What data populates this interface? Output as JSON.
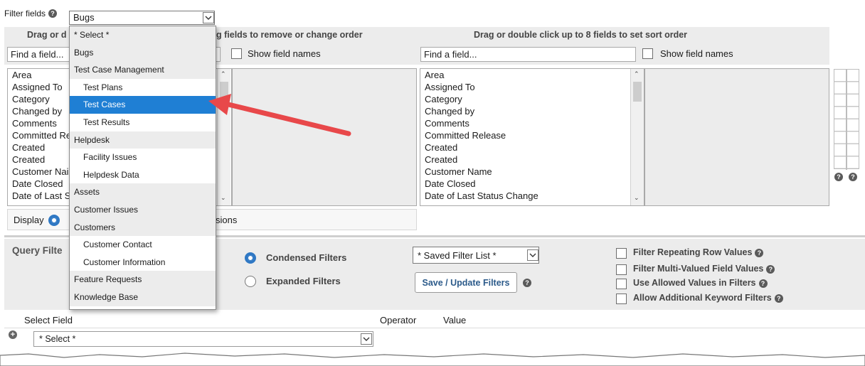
{
  "filter": {
    "label": "Filter fields",
    "selected": "Bugs"
  },
  "dropdown": {
    "items": [
      {
        "label": "* Select *",
        "kind": "group"
      },
      {
        "label": "Bugs",
        "kind": "group"
      },
      {
        "label": "Test Case Management",
        "kind": "group"
      },
      {
        "label": "Test Plans",
        "kind": "child"
      },
      {
        "label": "Test Cases",
        "kind": "child",
        "selected": true
      },
      {
        "label": "Test Results",
        "kind": "child"
      },
      {
        "label": "Helpdesk",
        "kind": "group"
      },
      {
        "label": "Facility Issues",
        "kind": "child"
      },
      {
        "label": "Helpdesk Data",
        "kind": "child"
      },
      {
        "label": "Assets",
        "kind": "group"
      },
      {
        "label": "Customer Issues",
        "kind": "group"
      },
      {
        "label": "Customers",
        "kind": "group"
      },
      {
        "label": "Customer Contact",
        "kind": "child"
      },
      {
        "label": "Customer Information",
        "kind": "child"
      },
      {
        "label": "Feature Requests",
        "kind": "group"
      },
      {
        "label": "Knowledge Base",
        "kind": "group"
      }
    ]
  },
  "left_panel": {
    "header_visible_start": "Drag or d",
    "header_visible_end": "g fields to remove or change order",
    "find_placeholder": "Find a field...",
    "show_field_names": "Show field names",
    "fields": [
      "Area",
      "Assigned To",
      "Category",
      "Changed by",
      "Comments",
      "Committed Re",
      "Created",
      "Created",
      "Customer Nai",
      "Date Closed",
      "Date of Last S"
    ],
    "display_label": "Display",
    "display_tail": "sions"
  },
  "right_panel": {
    "header": "Drag or double click up to 8 fields to set sort order",
    "find_placeholder": "Find a field...",
    "show_field_names": "Show field names",
    "fields": [
      "Area",
      "Assigned To",
      "Category",
      "Changed by",
      "Comments",
      "Committed Release",
      "Created",
      "Created",
      "Customer Name",
      "Date Closed",
      "Date of Last Status Change"
    ]
  },
  "query": {
    "title_visible": "Query Filte",
    "condensed": "Condensed Filters",
    "expanded": "Expanded Filters",
    "saved_filter": "* Saved Filter List *",
    "save_update": "Save / Update Filters",
    "options": [
      "Filter Repeating Row Values",
      "Filter Multi-Valued Field Values",
      "Use Allowed Values in Filters",
      "Allow Additional Keyword Filters"
    ]
  },
  "table": {
    "col_select_field": "Select Field",
    "col_operator": "Operator",
    "col_value": "Value",
    "row_select": "* Select *"
  },
  "colors": {
    "accent": "#1f7fd4",
    "arrow": "#e8484a",
    "band": "#ececec"
  }
}
